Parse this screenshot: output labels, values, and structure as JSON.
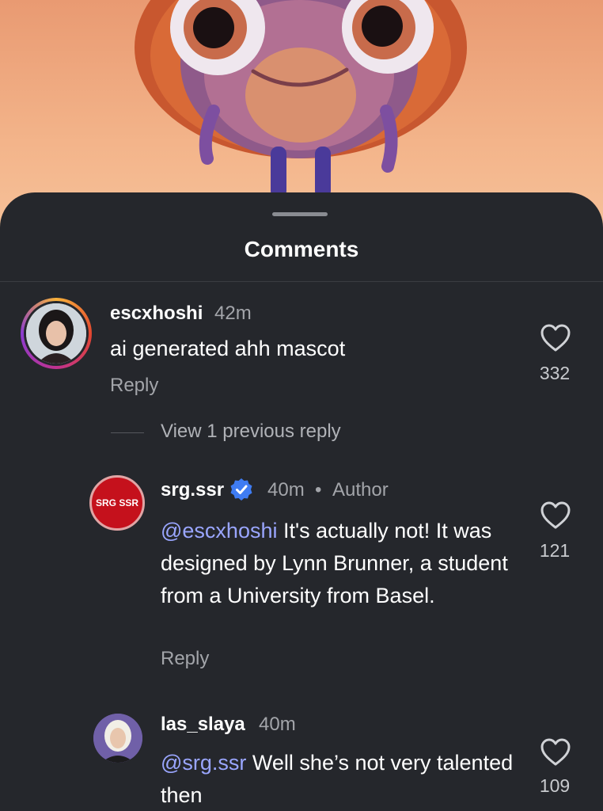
{
  "sheet": {
    "title": "Comments"
  },
  "comments": [
    {
      "username": "escxhoshi",
      "time": "42m",
      "text": "ai generated ahh mascot",
      "reply_label": "Reply",
      "likes": "332"
    },
    {
      "username": "srg.ssr",
      "time": "40m",
      "separator": "•",
      "badge": "Author",
      "avatar_text": "SRG SSR",
      "mention": "@escxhoshi",
      "text": " It's actually not! It was designed by Lynn Brunner, a student from a University from Basel.",
      "reply_label": "Reply",
      "likes": "121"
    },
    {
      "username": "las_slaya",
      "time": "40m",
      "mention": "@srg.ssr",
      "text": " Well she’s not very talented then",
      "likes": "109"
    }
  ],
  "view_previous": "View 1 previous reply",
  "colors": {
    "sheet_bg": "#25272c",
    "mention": "#9aa6ff",
    "verified": "#3f7cf3",
    "srg_red": "#c5111c"
  },
  "icons": [
    "heart-icon",
    "verified-icon"
  ]
}
